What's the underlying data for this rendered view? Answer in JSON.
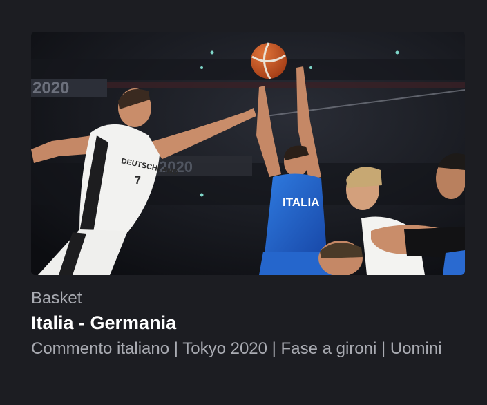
{
  "card": {
    "category": "Basket",
    "title": "Italia - Germania",
    "subtitle": "Commento italiano | Tokyo 2020 | Fase a gironi | Uomini"
  },
  "thumbnail": {
    "banner_text": "2020",
    "jersey_germany": "DEUTSCHLAND",
    "jersey_germany_number": "7",
    "jersey_italy": "ITALIA"
  },
  "colors": {
    "background": "#1c1d22",
    "title": "#ffffff",
    "meta": "#a9abb2",
    "italy_blue": "#1f5fc4"
  }
}
